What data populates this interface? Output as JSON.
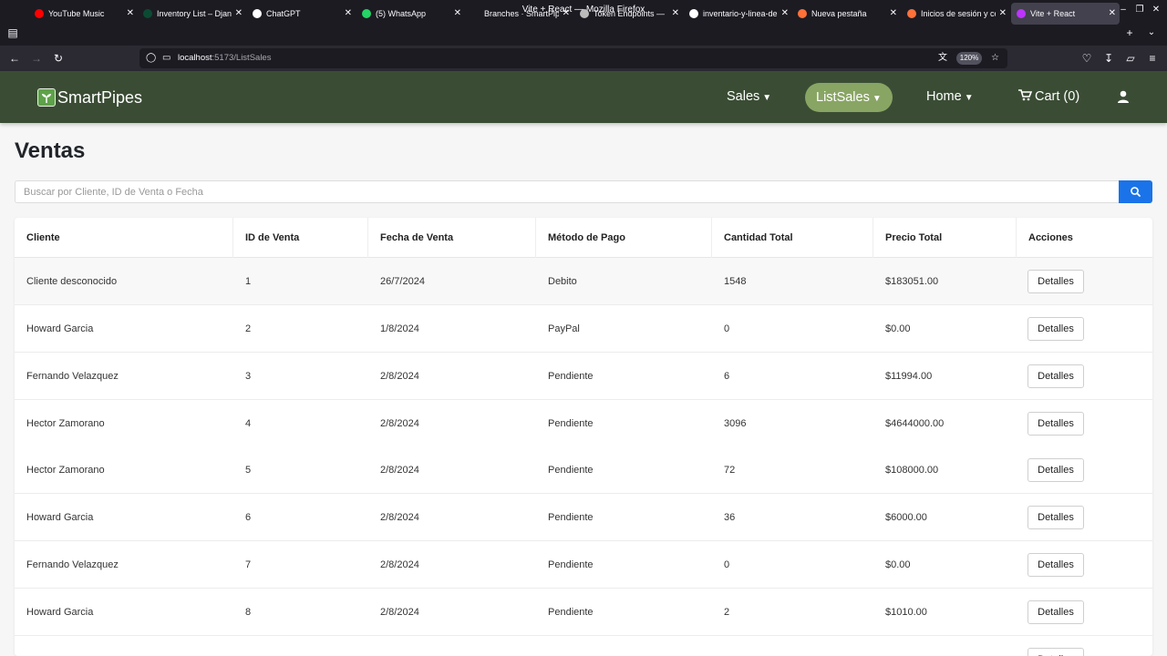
{
  "window": {
    "title": "Vite + React — Mozilla Firefox"
  },
  "tabs": [
    {
      "label": "YouTube Music",
      "icon": "youtube-music-icon",
      "color": "#ff0000"
    },
    {
      "label": "Inventory List – Django",
      "icon": "django-icon",
      "color": "#0c4b33"
    },
    {
      "label": "ChatGPT",
      "icon": "chatgpt-icon",
      "color": "#ffffff"
    },
    {
      "label": "(5) WhatsApp",
      "icon": "whatsapp-icon",
      "color": "#25d366"
    },
    {
      "label": "Branches · SmartPipes",
      "icon": "github-icon",
      "color": "#1c1b22"
    },
    {
      "label": "Token Endpoints —",
      "icon": "docs-icon",
      "color": "#bbbbbb"
    },
    {
      "label": "inventario-y-linea-de",
      "icon": "github-icon",
      "color": "#ffffff"
    },
    {
      "label": "Nueva pestaña",
      "icon": "firefox-icon",
      "color": "#ff7139"
    },
    {
      "label": "Inicios de sesión y co",
      "icon": "firefox-icon",
      "color": "#ff7139"
    },
    {
      "label": "Vite + React",
      "icon": "vite-icon",
      "color": "#bd34fe"
    }
  ],
  "browser": {
    "url_host": "localhost",
    "url_path": ":5173/ListSales",
    "zoom": "120%"
  },
  "app": {
    "brand": "SmartPipes",
    "nav": {
      "sales": "Sales",
      "listsales": "ListSales",
      "home": "Home",
      "cart": "Cart (0)"
    },
    "accent_color": "#89a564",
    "header_color": "#3a4d34"
  },
  "page": {
    "title": "Ventas",
    "search_placeholder": "Buscar por Cliente, ID de Venta o Fecha",
    "search_color": "#1a73e8"
  },
  "table": {
    "headers": [
      "Cliente",
      "ID de Venta",
      "Fecha de Venta",
      "Método de Pago",
      "Cantidad Total",
      "Precio Total",
      "Acciones"
    ],
    "action_label": "Detalles",
    "rows": [
      {
        "cliente": "Cliente desconocido",
        "id": "1",
        "fecha": "26/7/2024",
        "metodo": "Debito",
        "cantidad": "1548",
        "precio": "$183051.00"
      },
      {
        "cliente": "Howard Garcia",
        "id": "2",
        "fecha": "1/8/2024",
        "metodo": "PayPal",
        "cantidad": "0",
        "precio": "$0.00"
      },
      {
        "cliente": "Fernando Velazquez",
        "id": "3",
        "fecha": "2/8/2024",
        "metodo": "Pendiente",
        "cantidad": "6",
        "precio": "$11994.00"
      },
      {
        "cliente": "Hector Zamorano",
        "id": "4",
        "fecha": "2/8/2024",
        "metodo": "Pendiente",
        "cantidad": "3096",
        "precio": "$4644000.00"
      },
      {
        "cliente": "Hector Zamorano",
        "id": "5",
        "fecha": "2/8/2024",
        "metodo": "Pendiente",
        "cantidad": "72",
        "precio": "$108000.00"
      },
      {
        "cliente": "Howard Garcia",
        "id": "6",
        "fecha": "2/8/2024",
        "metodo": "Pendiente",
        "cantidad": "36",
        "precio": "$6000.00"
      },
      {
        "cliente": "Fernando Velazquez",
        "id": "7",
        "fecha": "2/8/2024",
        "metodo": "Pendiente",
        "cantidad": "0",
        "precio": "$0.00"
      },
      {
        "cliente": "Howard Garcia",
        "id": "8",
        "fecha": "2/8/2024",
        "metodo": "Pendiente",
        "cantidad": "2",
        "precio": "$1010.00"
      }
    ]
  }
}
